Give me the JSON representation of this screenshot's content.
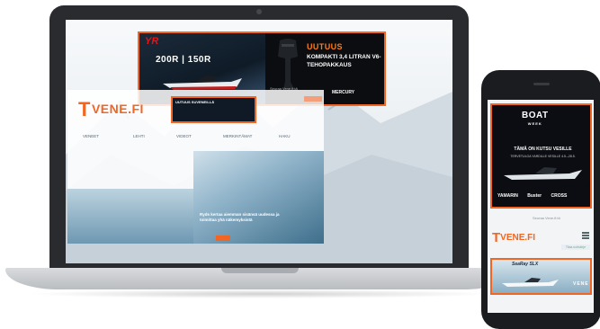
{
  "laptop": {
    "ad": {
      "brand_logo": "YR",
      "models": "200R | 150R",
      "headline": "UUTUUS",
      "copy": "KOMPAKTI 3,4 LITRAN V6-TEHOPAKKAUS",
      "footer_brand": "MERCURY"
    },
    "site": {
      "logo": "VENE.FI",
      "nav_items": [
        "VENEET",
        "LEHTI",
        "VIDEOT",
        "MERKINTÄMAT",
        "HAKU"
      ],
      "hero_title": "Ryds kertaa aiemman sisänsä uudessa ja toimittaa yhä näkemyksistä",
      "follow_text": "Seuraa Vene.fi:tä",
      "small_ad_text": "UUTUUS SUVENEILLÄ"
    },
    "colors": {
      "accent": "#f26522",
      "ad_bg": "#0b0d10"
    }
  },
  "phone": {
    "ad": {
      "title": "BOAT",
      "subtitle": "WEEK",
      "invite": "TÄMÄ ON KUTSU VESILLE",
      "dates": "TERVETULOA YARDILLE VESILLE 4.5.–28.5.",
      "brands": [
        "YAMARIN",
        "Buster",
        "CROSS"
      ]
    },
    "follow_text": "Seuraa Vene.fi:tä",
    "logo": "VENE.FI",
    "pill": "Tilaa uutiskirje",
    "bottom_ad": {
      "title": "SeaRay SLX",
      "word": "VENE"
    }
  }
}
